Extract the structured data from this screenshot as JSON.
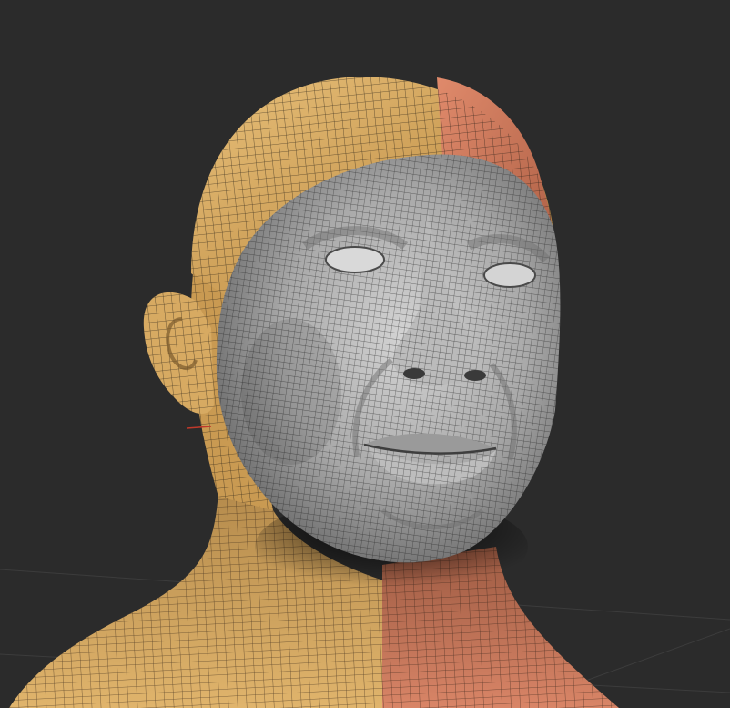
{
  "viewport": {
    "background_color": "#2b2b2b",
    "grid_line_color": "#3a3a3a"
  },
  "model": {
    "kind": "3d-head-bust-wireframe",
    "polygroup_colors": {
      "skull_neck_left": "#d9ac63",
      "skull_neck_right": "#cf7d5f",
      "face_mask": "#a8a8a8",
      "ear": "#d9ac63",
      "wire": "#2a2016"
    }
  }
}
